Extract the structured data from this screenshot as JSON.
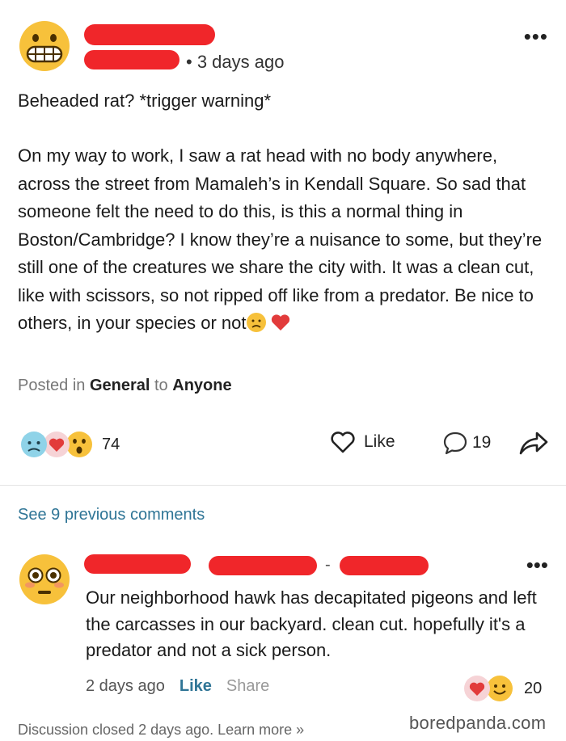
{
  "post": {
    "timestamp": "• 3 days ago",
    "title": "Beheaded rat? *trigger warning*",
    "body": "On my way to work, I saw a rat head with no body anywhere, across the street from Mamaleh’s in Kendall Square. So sad that someone felt the need to do this, is this a normal thing in Boston/Cambridge? I know they’re a nuisance to some, but they’re still one of the creatures we share the city with. It was a clean cut, like with scissors, so not ripped off like from a predator. Be nice to others, in your species or not",
    "posted_in_prefix": "Posted in",
    "category": "General",
    "to_label": "to",
    "audience": "Anyone",
    "reaction_count": "74",
    "like_label": "Like",
    "comment_count": "19"
  },
  "see_previous": "See 9 previous comments",
  "comment": {
    "name_separator": "-",
    "body": "Our neighborhood hawk has decapitated pigeons and left the carcasses in our backyard. clean cut. hopefully it's a predator and not a sick person.",
    "time": "2 days ago",
    "like_label": "Like",
    "share_label": "Share",
    "reaction_count": "20"
  },
  "footer": "Discussion closed 2 days ago. Learn more »",
  "watermark": "boredpanda.com",
  "icons": {
    "author_avatar": "grimacing-face-icon",
    "commenter_avatar": "flushed-face-icon",
    "more": "more-dots-icon",
    "like": "heart-outline-icon",
    "comment": "speech-bubble-icon",
    "share": "share-arrow-icon"
  },
  "colors": {
    "link": "#2f7596",
    "redaction": "#f0262a",
    "emoji_yellow": "#f7c13b",
    "heart": "#e23b3b"
  }
}
